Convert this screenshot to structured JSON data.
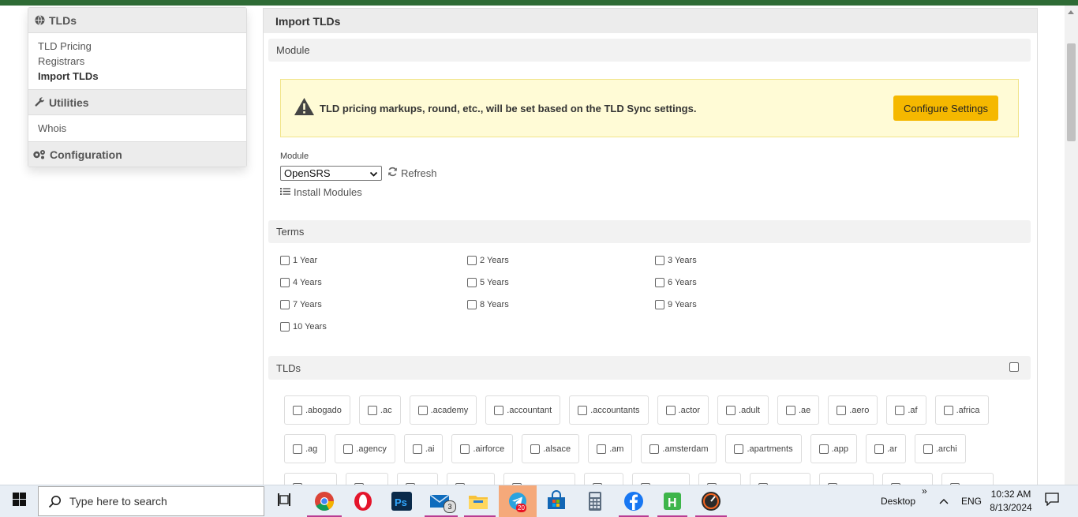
{
  "colors": {
    "topbar": "#2e6b35",
    "accent": "#f5b800",
    "alert_bg": "#fffbd6"
  },
  "sidebar": {
    "tlds": {
      "title": "TLDs",
      "icon": "globe-icon",
      "items": [
        {
          "label": "TLD Pricing",
          "active": false
        },
        {
          "label": "Registrars",
          "active": false
        },
        {
          "label": "Import TLDs",
          "active": true
        }
      ]
    },
    "utilities": {
      "title": "Utilities",
      "icon": "wrench-icon",
      "items": [
        {
          "label": "Whois"
        }
      ]
    },
    "configuration": {
      "title": "Configuration",
      "icon": "gears-icon"
    }
  },
  "main": {
    "title": "Import TLDs",
    "module_section": {
      "title": "Module"
    },
    "alert": {
      "message": "TLD pricing markups, round, etc., will be set based on the TLD Sync settings.",
      "button": "Configure Settings"
    },
    "module_field": {
      "label": "Module",
      "selected": "OpenSRS",
      "refresh": "Refresh",
      "install": "Install Modules"
    },
    "terms_section": {
      "title": "Terms",
      "items": [
        "1 Year",
        "2 Years",
        "3 Years",
        "4 Years",
        "5 Years",
        "6 Years",
        "7 Years",
        "8 Years",
        "9 Years",
        "10 Years"
      ]
    },
    "tlds_section": {
      "title": "TLDs",
      "row1": [
        ".abogado",
        ".ac",
        ".academy",
        ".accountant",
        ".accountants",
        ".actor",
        ".adult",
        ".ae",
        ".aero",
        ".af",
        ".africa"
      ],
      "row2": [
        ".ag",
        ".agency",
        ".ai",
        ".airforce",
        ".alsace",
        ".am",
        ".amsterdam",
        ".apartments",
        ".app",
        ".ar",
        ".archi"
      ]
    }
  },
  "taskbar": {
    "search_placeholder": "Type here to search",
    "mail_badge": "3",
    "telegram_badge": "20",
    "desktop_label": "Desktop",
    "overflow": "»",
    "language": "ENG",
    "time": "10:32 AM",
    "date": "8/13/2024",
    "apps": [
      "chrome-icon",
      "opera-icon",
      "photoshop-icon",
      "mail-icon",
      "file-explorer-icon",
      "telegram-icon",
      "store-icon",
      "calculator-icon",
      "facebook-icon",
      "hotspot-icon",
      "speedtest-icon"
    ]
  }
}
